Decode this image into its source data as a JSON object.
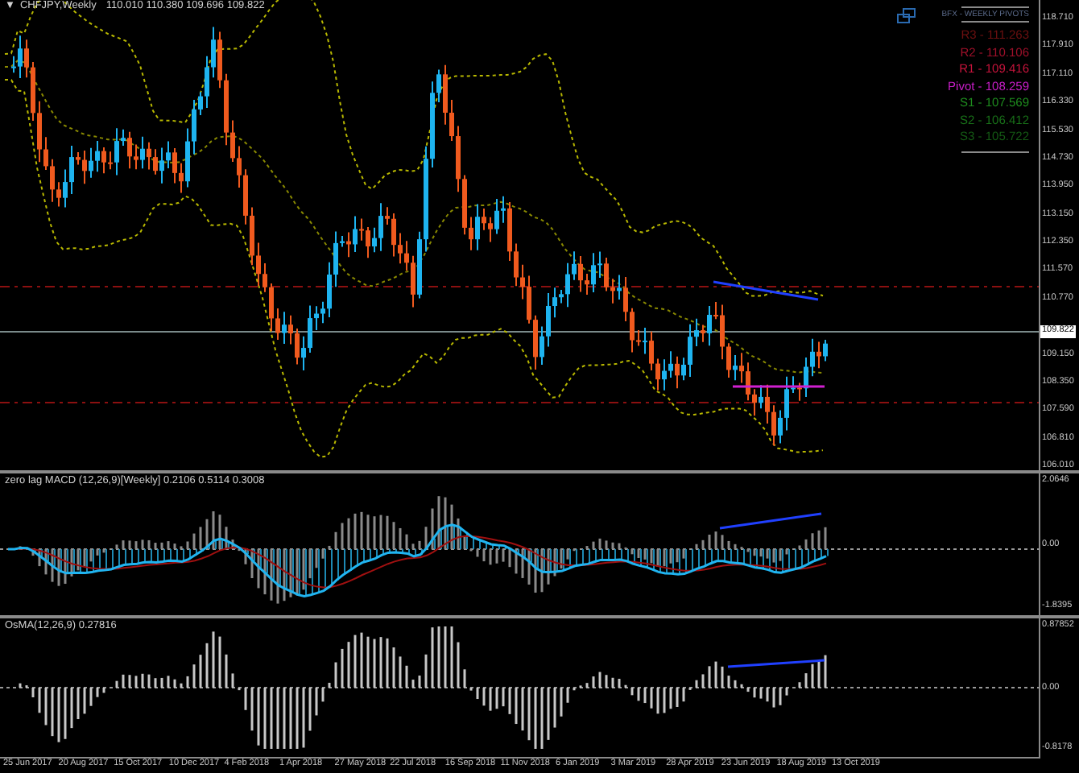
{
  "main_chart": {
    "title_marker": "▼",
    "title": "CHFJPY,Weekly",
    "ohlc": "110.010 110.380 109.696 109.822",
    "price_axis": [
      "118.710",
      "117.910",
      "117.110",
      "116.330",
      "115.530",
      "114.730",
      "113.950",
      "113.150",
      "112.350",
      "111.570",
      "110.770",
      "109.150",
      "108.350",
      "107.590",
      "106.810",
      "106.010"
    ],
    "current_price": "109.822",
    "pivots_panel": {
      "title": "BFX - WEEKLY PIVOTS",
      "levels": [
        {
          "label": "R3 - 111.263",
          "color": "#6e1010"
        },
        {
          "label": "R2 - 110.106",
          "color": "#a0102a"
        },
        {
          "label": "R1 - 109.416",
          "color": "#c8143c"
        },
        {
          "label": "Pivot - 108.259",
          "color": "#c81ec8"
        },
        {
          "label": "S1 - 107.569",
          "color": "#1e8c1e"
        },
        {
          "label": "S2 - 106.412",
          "color": "#187018"
        },
        {
          "label": "S3 - 105.722",
          "color": "#145a14"
        }
      ]
    }
  },
  "macd_panel": {
    "title": "zero lag MACD (12,26,9)[Weekly] 0.2106 0.5114 0.3008",
    "axis": [
      "2.0646",
      "0.00",
      "-1.8395"
    ]
  },
  "osma_panel": {
    "title": "OsMA(12,26,9) 0.27816",
    "axis": [
      "0.87852",
      "0.00",
      "-0.8178"
    ]
  },
  "time_axis": [
    "25 Jun 2017",
    "20 Aug 2017",
    "15 Oct 2017",
    "10 Dec 2017",
    "4 Feb 2018",
    "1 Apr 2018",
    "27 May 2018",
    "22 Jul 2018",
    "16 Sep 2018",
    "11 Nov 2018",
    "6 Jan 2019",
    "3 Mar 2019",
    "28 Apr 2019",
    "23 Jun 2019",
    "18 Aug 2019",
    "13 Oct 2019"
  ]
}
